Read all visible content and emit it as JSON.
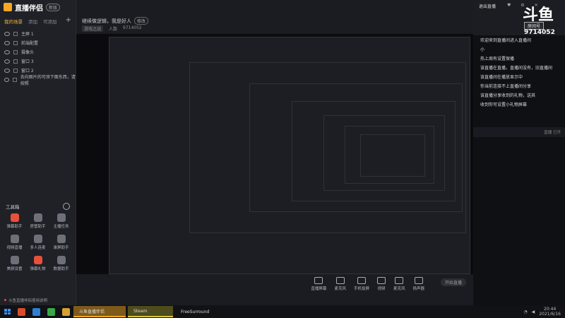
{
  "app": {
    "name": "直播伴侣",
    "version_badge": "新版"
  },
  "sidebar": {
    "tabs": [
      "我的场景",
      "添加",
      "可添加"
    ],
    "scenes": [
      {
        "label": "主屏 1"
      },
      {
        "label": "前端配置"
      },
      {
        "label": "摄像头"
      },
      {
        "label": "窗口 3"
      },
      {
        "label": "窗口 2"
      },
      {
        "label": "去向图片的可添下面东西，请按照"
      }
    ],
    "toolbox_title": "工具箱",
    "tools": [
      {
        "label": "弹幕助手",
        "color": "red"
      },
      {
        "label": "房管助手",
        "color": "grey"
      },
      {
        "label": "主播任务",
        "color": "grey"
      },
      {
        "label": "视频直播",
        "color": "grey"
      },
      {
        "label": "多人连麦",
        "color": "grey"
      },
      {
        "label": "录屏助手",
        "color": "grey"
      },
      {
        "label": "美颜设置",
        "color": "grey"
      },
      {
        "label": "弹幕礼物",
        "color": "red"
      },
      {
        "label": "数据助手",
        "color": "grey"
      }
    ],
    "notice": "斗鱼直播伴侣使用说明"
  },
  "stream": {
    "title": "继续做逻辑，我是好人",
    "edit_label": "修改",
    "category": "游戏之战",
    "viewers_label": "人数",
    "room_id": "9714052"
  },
  "controls": [
    {
      "label": "直播屏幕"
    },
    {
      "label": "麦克风"
    },
    {
      "label": "手机投屏"
    },
    {
      "label": "视频"
    },
    {
      "label": "麦克风"
    },
    {
      "label": "扬声器"
    }
  ],
  "start_button": "开始直播",
  "right_panel": {
    "close_label": "退出直播",
    "brand": "斗鱼",
    "room_label": "房间号",
    "room_number": "9714052",
    "chat": [
      "欢迎来到直播间进入直播间",
      "小",
      "热上周有设置保播",
      "该直播在直播，直播间没有，旧直播间",
      "该直播间在播放显示中",
      "你当前连接不上直播间分享",
      "该直播分享收到的礼物，送其",
      "收到你可设置小礼物屏幕"
    ],
    "footer": "直播 已开"
  },
  "taskbar": {
    "apps": [
      "斗鱼直播伴侣",
      "Steam",
      "FreeSurround"
    ],
    "time": "20:44",
    "date": "2021/6/16"
  },
  "colors": {
    "accent": "#f6a623",
    "danger": "#e8503a"
  }
}
